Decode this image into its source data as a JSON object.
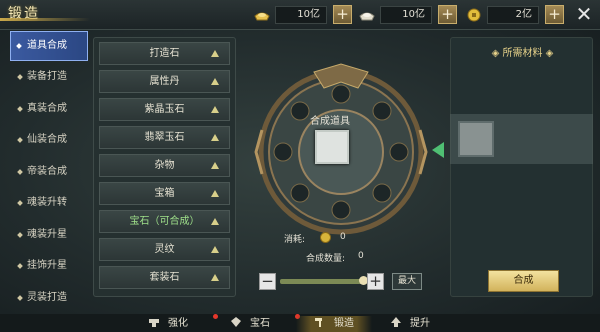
{
  "header": {
    "title": "锻造"
  },
  "resources": [
    {
      "icon": "gold-ingot-icon",
      "amount": "10亿"
    },
    {
      "icon": "silver-ingot-icon",
      "amount": "10亿"
    },
    {
      "icon": "coin-icon",
      "amount": "2亿"
    }
  ],
  "tabs": [
    "道具合成",
    "装备打造",
    "真装合成",
    "仙装合成",
    "帝装合成",
    "魂装升转",
    "魂装升星",
    "挂饰升星",
    "灵装打造"
  ],
  "active_tab": "道具合成",
  "items": [
    "打造石",
    "属性丹",
    "紫晶玉石",
    "翡翠玉石",
    "杂物",
    "宝箱",
    "宝石（可合成）",
    "灵纹",
    "套装石"
  ],
  "center": {
    "combine_label": "合成道具",
    "cost_label": "消耗:",
    "cost_value": "0",
    "qty_label": "合成数量:",
    "qty_value": "0",
    "max_label": "最大"
  },
  "right": {
    "title": "◈ 所需材料 ◈",
    "compose_label": "合成"
  },
  "bottom_nav": [
    "强化",
    "宝石",
    "锻造",
    "提升"
  ],
  "colors": {
    "accent": "#3b5aa0",
    "gold": "#d8b43a",
    "selected_item": "#9fe08a"
  }
}
